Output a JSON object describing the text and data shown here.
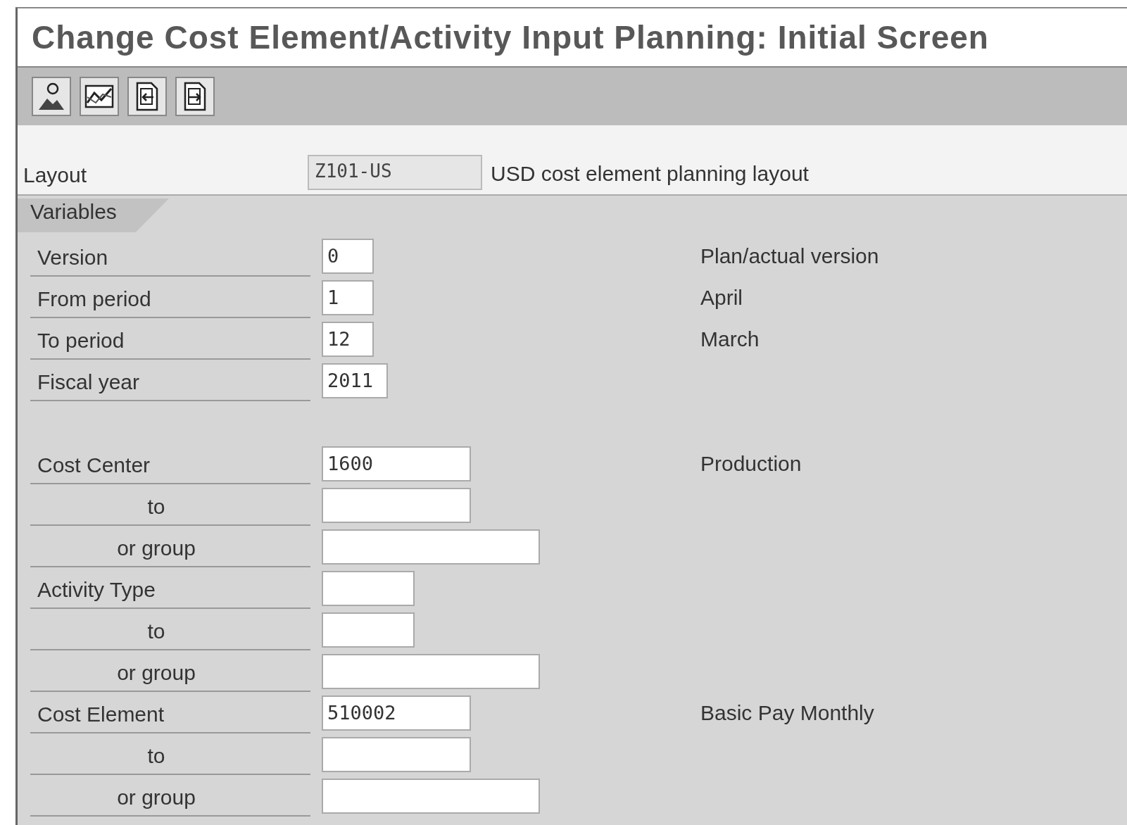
{
  "window": {
    "title": "Change Cost Element/Activity Input Planning: Initial Screen"
  },
  "toolbar": {
    "buttons": [
      {
        "kind": "person"
      },
      {
        "kind": "chart"
      },
      {
        "kind": "doc-in"
      },
      {
        "kind": "doc-out"
      }
    ]
  },
  "layout": {
    "label": "Layout",
    "value": "Z101-US",
    "description": "USD cost element planning layout"
  },
  "variables": {
    "tab": "Variables",
    "rows": [
      {
        "kind": "main",
        "label": "Version",
        "field": {
          "kind": "tiny",
          "value": "0"
        },
        "description": "Plan/actual version"
      },
      {
        "kind": "main",
        "label": "From period",
        "field": {
          "kind": "tiny",
          "value": "1"
        },
        "description": "April"
      },
      {
        "kind": "main",
        "label": "To period",
        "field": {
          "kind": "tiny",
          "value": "12"
        },
        "description": "March"
      },
      {
        "kind": "main",
        "label": "Fiscal year",
        "field": {
          "kind": "short",
          "value": "2011"
        }
      },
      {
        "kind": "gap"
      },
      {
        "kind": "main",
        "label": "Cost Center",
        "field": {
          "kind": "medium",
          "value": "1600"
        },
        "description": "Production"
      },
      {
        "kind": "sub",
        "label": "to",
        "field": {
          "kind": "medium"
        }
      },
      {
        "kind": "sub",
        "label": "or group",
        "field": {
          "kind": "wide"
        }
      },
      {
        "kind": "main",
        "label": "Activity Type",
        "field": {
          "kind": "narrow"
        }
      },
      {
        "kind": "sub",
        "label": "to",
        "field": {
          "kind": "narrow"
        }
      },
      {
        "kind": "sub",
        "label": "or group",
        "field": {
          "kind": "wide"
        }
      },
      {
        "kind": "main",
        "label": "Cost Element",
        "field": {
          "kind": "medium",
          "value": "510002"
        },
        "description": "Basic Pay Monthly"
      },
      {
        "kind": "sub",
        "label": "to",
        "field": {
          "kind": "medium"
        }
      },
      {
        "kind": "sub",
        "label": "or group",
        "field": {
          "kind": "wide"
        }
      }
    ]
  }
}
